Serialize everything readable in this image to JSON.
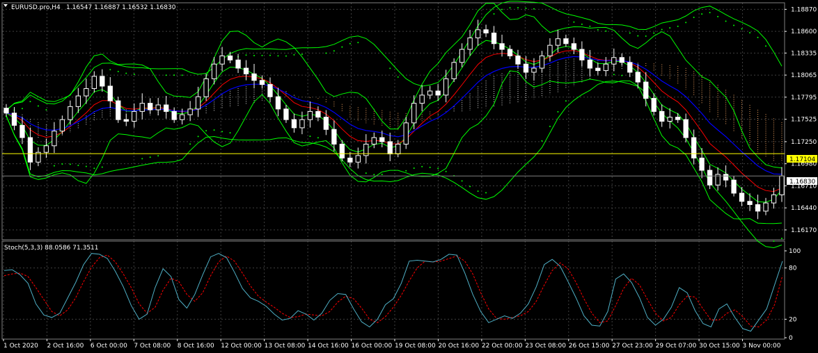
{
  "window": {
    "symbol_title": "EURUSD.pro,H4",
    "ohlc": "1.16547 1.16887 1.16532 1.16830",
    "indicator_label": "Stoch(5,3,3) 88.0586 71.3511"
  },
  "price_axis": {
    "ticks": [
      "1.18870",
      "1.18600",
      "1.18335",
      "1.18065",
      "1.17795",
      "1.17525",
      "1.17250",
      "1.16980",
      "1.16710",
      "1.16440",
      "1.16170"
    ],
    "current_price": "1.16830",
    "horizontal_line": "1.17104"
  },
  "stoch_axis": {
    "ticks": [
      "100",
      "80",
      "20",
      "0"
    ]
  },
  "time_axis": {
    "ticks": [
      "1 Oct 2020",
      "2 Oct 16:00",
      "6 Oct 00:00",
      "7 Oct 08:00",
      "8 Oct 16:00",
      "12 Oct 00:00",
      "13 Oct 08:00",
      "14 Oct 16:00",
      "16 Oct 00:00",
      "19 Oct 08:00",
      "20 Oct 16:00",
      "22 Oct 00:00",
      "23 Oct 08:00",
      "26 Oct 15:00",
      "27 Oct 23:00",
      "29 Oct 07:00",
      "30 Oct 15:00",
      "3 Nov 00:00"
    ]
  },
  "colors": {
    "background": "#000000",
    "grid": "#404040",
    "hline": "#ffff00",
    "ema_fast": "#ff0000",
    "ema_slow": "#0000ff",
    "bands": "#00ff00",
    "stoch_main": "#4fb0c6",
    "stoch_signal": "#ff0000",
    "cloud_bull": "#f4a460",
    "cloud_bear": "#dcdcdc",
    "sar": "#00ff00"
  },
  "chart_data": {
    "type": "candlestick",
    "title": "EURUSD.pro,H4",
    "ylim": [
      1.1605,
      1.1895
    ],
    "closes": [
      1.176,
      1.1745,
      1.173,
      1.17,
      1.1712,
      1.172,
      1.1738,
      1.1752,
      1.1768,
      1.1781,
      1.179,
      1.1805,
      1.1793,
      1.1775,
      1.1752,
      1.175,
      1.1762,
      1.1772,
      1.1764,
      1.177,
      1.1762,
      1.1752,
      1.1758,
      1.1765,
      1.178,
      1.1802,
      1.182,
      1.183,
      1.1825,
      1.1815,
      1.1808,
      1.18,
      1.1795,
      1.178,
      1.1765,
      1.1752,
      1.1742,
      1.1752,
      1.1762,
      1.1755,
      1.174,
      1.1722,
      1.1705,
      1.17,
      1.1708,
      1.1722,
      1.173,
      1.1725,
      1.171,
      1.1722,
      1.1748,
      1.1772,
      1.1782,
      1.1787,
      1.1782,
      1.1802,
      1.1822,
      1.1838,
      1.1852,
      1.1862,
      1.1858,
      1.1845,
      1.1838,
      1.183,
      1.182,
      1.181,
      1.1815,
      1.183,
      1.1843,
      1.1851,
      1.1845,
      1.1838,
      1.1825,
      1.1815,
      1.1812,
      1.182,
      1.1828,
      1.1822,
      1.181,
      1.1798,
      1.1778,
      1.1762,
      1.175,
      1.1755,
      1.1752,
      1.173,
      1.1705,
      1.169,
      1.1672,
      1.1685,
      1.1678,
      1.1662,
      1.1652,
      1.1648,
      1.164,
      1.165,
      1.166,
      1.1683
    ],
    "stoch": {
      "main": [
        77,
        78,
        72,
        62,
        38,
        25,
        22,
        27,
        45,
        63,
        84,
        97,
        96,
        91,
        76,
        58,
        36,
        20,
        26,
        57,
        79,
        70,
        43,
        33,
        49,
        72,
        93,
        97,
        92,
        75,
        56,
        45,
        41,
        35,
        26,
        19,
        21,
        30,
        26,
        19,
        27,
        42,
        50,
        49,
        32,
        17,
        11,
        20,
        37,
        44,
        62,
        88,
        89,
        88,
        87,
        90,
        96,
        95,
        74,
        49,
        29,
        16,
        20,
        24,
        21,
        27,
        38,
        58,
        84,
        90,
        82,
        64,
        45,
        24,
        13,
        12,
        29,
        67,
        73,
        63,
        45,
        22,
        13,
        20,
        34,
        57,
        51,
        30,
        15,
        11,
        32,
        38,
        22,
        9,
        6,
        19,
        32,
        60,
        88
      ],
      "signal": [
        71,
        73,
        74,
        70,
        57,
        43,
        29,
        24,
        31,
        45,
        64,
        81,
        92,
        95,
        87,
        73,
        57,
        38,
        27,
        34,
        54,
        68,
        64,
        49,
        41,
        51,
        71,
        87,
        94,
        88,
        74,
        59,
        47,
        40,
        34,
        27,
        22,
        23,
        26,
        25,
        24,
        29,
        40,
        47,
        44,
        33,
        20,
        16,
        23,
        34,
        48,
        65,
        80,
        88,
        87,
        88,
        91,
        94,
        88,
        73,
        51,
        32,
        21,
        20,
        22,
        24,
        29,
        41,
        60,
        77,
        86,
        79,
        63,
        44,
        27,
        16,
        18,
        36,
        56,
        68,
        60,
        43,
        27,
        18,
        22,
        37,
        47,
        46,
        32,
        19,
        19,
        27,
        31,
        23,
        12,
        11,
        19,
        37,
        71
      ]
    }
  }
}
